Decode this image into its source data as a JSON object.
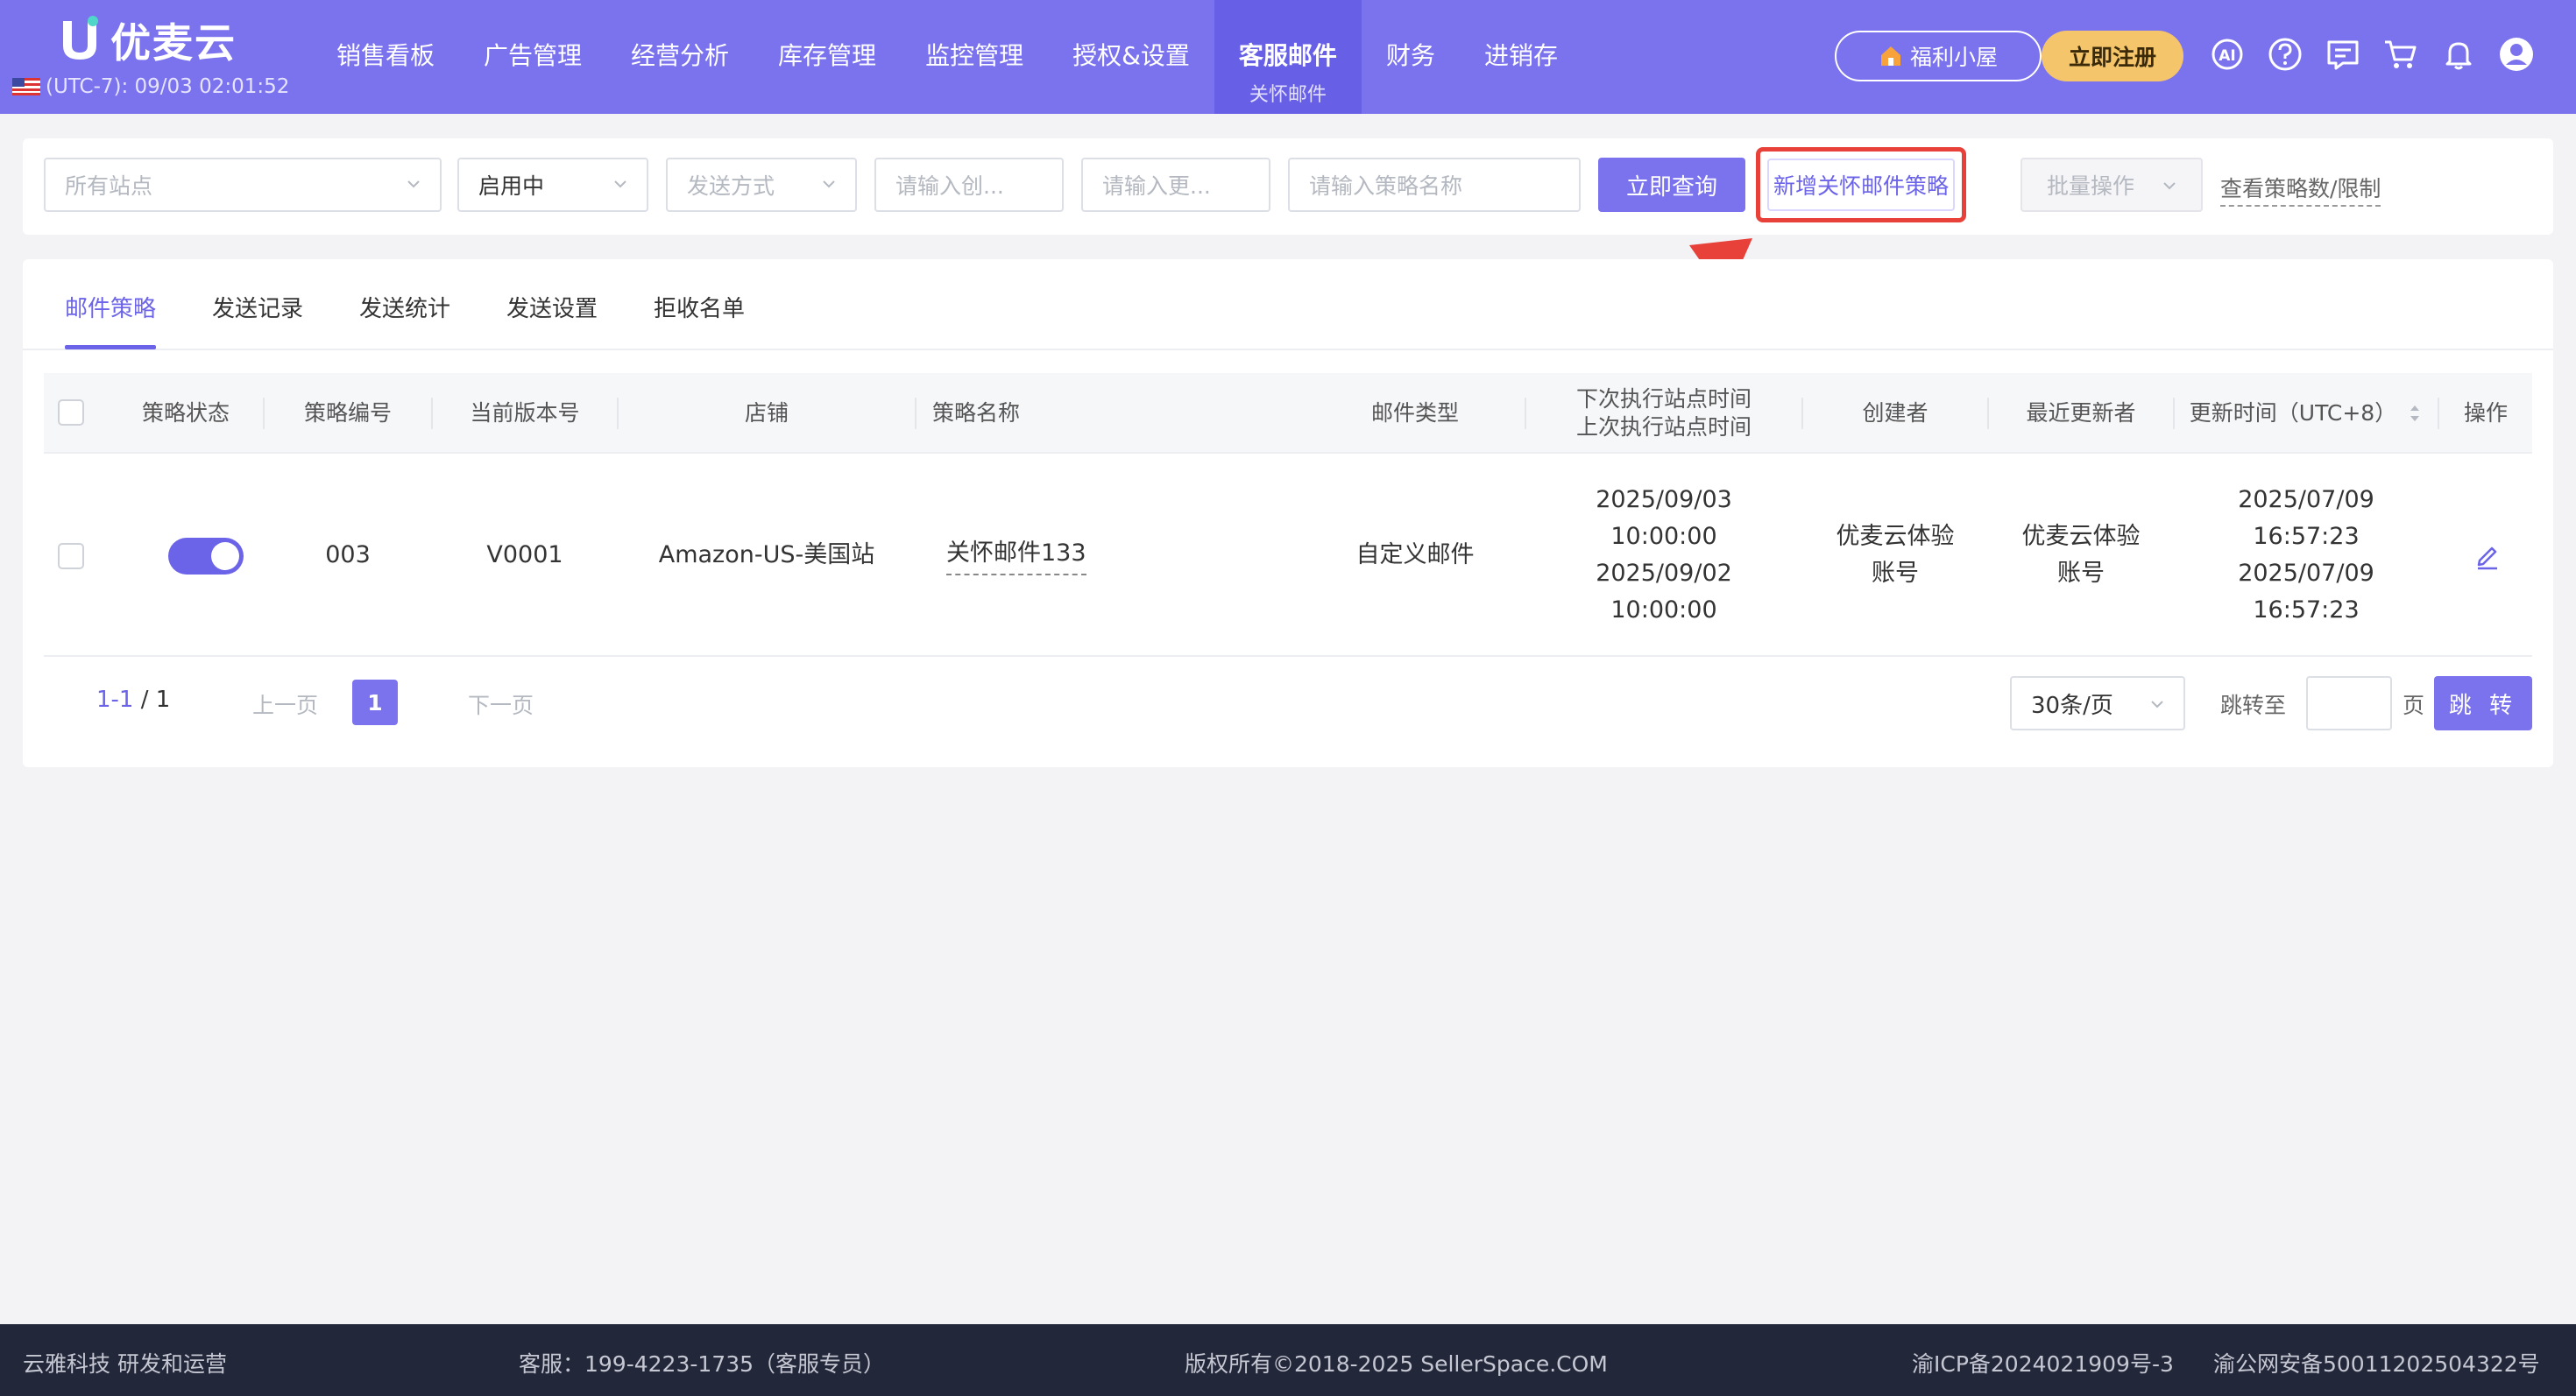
{
  "header": {
    "brand": "优麦云",
    "timezone": "(UTC-7): 09/03 02:01:52",
    "menu": [
      {
        "label": "销售看板"
      },
      {
        "label": "广告管理"
      },
      {
        "label": "经营分析"
      },
      {
        "label": "库存管理"
      },
      {
        "label": "监控管理"
      },
      {
        "label": "授权&设置"
      },
      {
        "label": "客服邮件",
        "sub": "关怀邮件",
        "active": true
      },
      {
        "label": "财务"
      },
      {
        "label": "进销存"
      }
    ],
    "welfare_label": "福利小屋",
    "register_label": "立即注册",
    "icons": [
      "ai-icon",
      "help-icon",
      "message-icon",
      "cart-icon",
      "bell-icon",
      "user-avatar-icon"
    ],
    "brand_color": "#7b73ee"
  },
  "filters": {
    "site_placeholder": "所有站点",
    "status_value": "启用中",
    "send_method_placeholder": "发送方式",
    "creator_placeholder": "请输入创...",
    "updater_placeholder": "请输入更...",
    "strategy_name_placeholder": "请输入策略名称",
    "query_label": "立即查询",
    "new_strategy_label": "新增关怀邮件策略",
    "batch_label": "批量操作",
    "view_limit_label": "查看策略数/限制"
  },
  "tabs": [
    {
      "label": "邮件策略",
      "active": true
    },
    {
      "label": "发送记录"
    },
    {
      "label": "发送统计"
    },
    {
      "label": "发送设置"
    },
    {
      "label": "拒收名单"
    }
  ],
  "table": {
    "columns": {
      "status": "策略状态",
      "id": "策略编号",
      "version": "当前版本号",
      "store": "店铺",
      "name": "策略名称",
      "type": "邮件类型",
      "next_time": "下次执行站点时间",
      "last_time": "上次执行站点时间",
      "creator": "创建者",
      "updater": "最近更新者",
      "update_time": "更新时间（UTC+8）",
      "action": "操作"
    },
    "rows": [
      {
        "enabled": true,
        "id": "003",
        "version": "V0001",
        "store": "Amazon-US-美国站",
        "name": "关怀邮件133",
        "type": "自定义邮件",
        "next_date": "2025/09/03",
        "next_clock": "10:00:00",
        "last_date": "2025/09/02",
        "last_clock": "10:00:00",
        "creator_1": "优麦云体验",
        "creator_2": "账号",
        "updater_1": "优麦云体验",
        "updater_2": "账号",
        "upd_date_1": "2025/07/09",
        "upd_clock_1": "16:57:23",
        "upd_date_2": "2025/07/09",
        "upd_clock_2": "16:57:23"
      }
    ]
  },
  "pagination": {
    "range": "1-1",
    "total": "/ 1",
    "prev_label": "上一页",
    "current_page": "1",
    "next_label": "下一页",
    "per_page": "30条/页",
    "jump_label": "跳转至",
    "page_unit": "页",
    "jump_button": "跳 转"
  },
  "footer": {
    "company": "云雅科技 研发和运营",
    "service": "客服：199-4223-1735（客服专员）",
    "copyright": "版权所有©2018-2025 SellerSpace.COM",
    "icp": "渝ICP备2024021909号-3",
    "police": "渝公网安备50011202504322号"
  }
}
